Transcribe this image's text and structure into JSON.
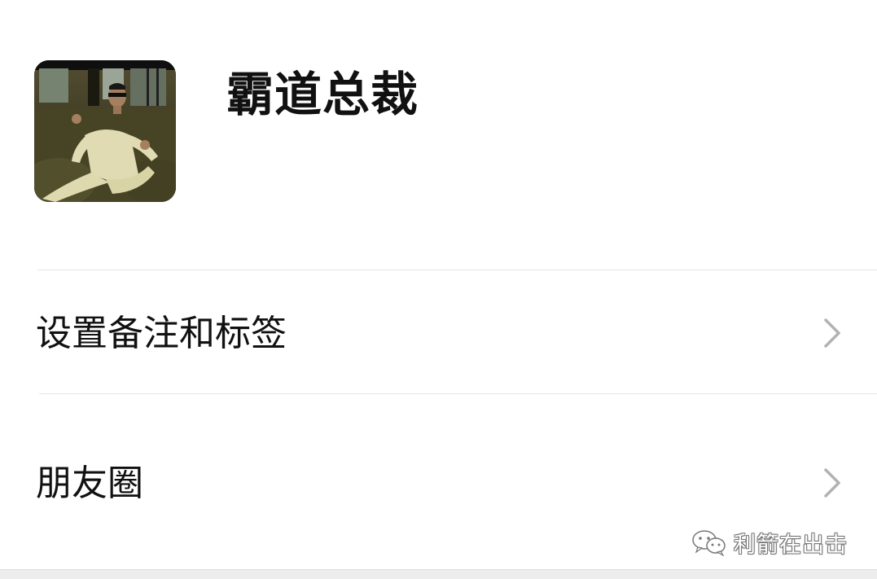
{
  "profile": {
    "nickname": "霸道总裁",
    "avatar_icon": "profile-photo-man-in-white-suit"
  },
  "menu": {
    "items": [
      {
        "label": "设置备注和标签",
        "icon": "chevron-right-icon"
      },
      {
        "label": "朋友圈",
        "icon": "chevron-right-icon"
      }
    ]
  },
  "watermark": {
    "text": "利箭在出击",
    "icon": "wechat-icon"
  },
  "colors": {
    "background": "#ffffff",
    "text": "#111111",
    "divider": "#e5e5e5",
    "chevron": "#b2b2b2",
    "bottom_strip": "#ededed"
  }
}
